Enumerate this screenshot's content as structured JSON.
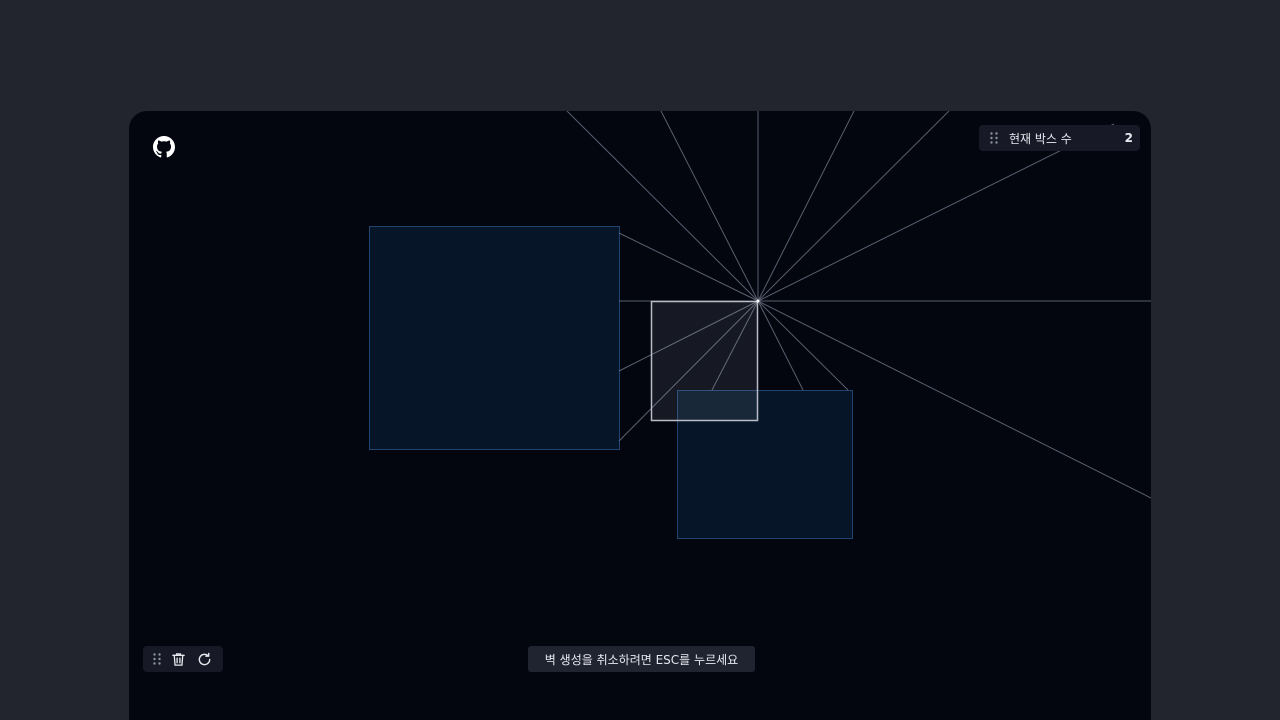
{
  "counter": {
    "label": "현재 박스 수",
    "value": "2",
    "handle_icon": "drag-handle-icon"
  },
  "toolbar": {
    "handle_icon": "drag-handle-icon",
    "delete_icon": "trash-icon",
    "reset_icon": "refresh-icon"
  },
  "hint": {
    "text": "벽 생성을 취소하려면 ESC를 누르세요"
  },
  "header": {
    "logo_icon": "github-icon"
  },
  "colors": {
    "page_bg": "#22242e",
    "canvas_bg": "#03050f",
    "box_fill": "#061628",
    "box_stroke": "#1f4470",
    "active_box_stroke": "#b9bcc6",
    "ray": "#6a7080"
  }
}
